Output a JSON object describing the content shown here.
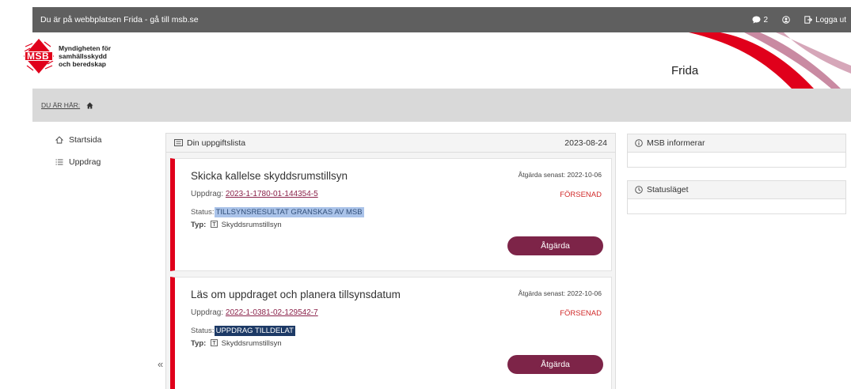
{
  "topbar": {
    "notice": "Du är på webbplatsen Frida - gå till msb.se",
    "messages_count": "2",
    "logout_label": "Logga ut"
  },
  "header": {
    "logo_line1": "Myndigheten för",
    "logo_line2": "samhällsskydd",
    "logo_line3": "och beredskap",
    "logo_badge": "MSB",
    "app_name": "Frida"
  },
  "breadcrumb": {
    "label": "DU ÄR HÄR:"
  },
  "sidebar": {
    "items": [
      {
        "label": "Startsida",
        "icon": "home-outline-icon"
      },
      {
        "label": "Uppdrag",
        "icon": "list-icon"
      }
    ],
    "collapse_glyph": "«"
  },
  "tasklist": {
    "title": "Din uppgiftslista",
    "date": "2023-08-24",
    "tasks": [
      {
        "title": "Skicka kallelse skyddsrumstillsyn",
        "due": "Åtgärda senast: 2022-10-06",
        "uppdrag_label": "Uppdrag:",
        "uppdrag_id": "2023-1-1780-01-144354-5",
        "late": "FÖRSENAD",
        "status_label": "Status:",
        "status_value": "TILLSYNSRESULTAT GRANSKAS AV MSB",
        "typ_label": "Typ:",
        "typ_value": "Skyddsrumstillsyn",
        "button": "Åtgärda"
      },
      {
        "title": "Läs om uppdraget och planera tillsynsdatum",
        "due": "Åtgärda senast: 2022-10-06",
        "uppdrag_label": "Uppdrag:",
        "uppdrag_id": "2022-1-0381-02-129542-7",
        "late": "FÖRSENAD",
        "status_label": "Status:",
        "status_value": "UPPDRAG TILLDELAT",
        "typ_label": "Typ:",
        "typ_value": "Skyddsrumstillsyn",
        "button": "Åtgärda"
      }
    ]
  },
  "panels": {
    "info_title": "MSB informerar",
    "status_title": "Statusläget"
  },
  "colors": {
    "accent": "#7d2448",
    "alert_red": "#e0001b",
    "topbar": "#5f5f5f"
  }
}
